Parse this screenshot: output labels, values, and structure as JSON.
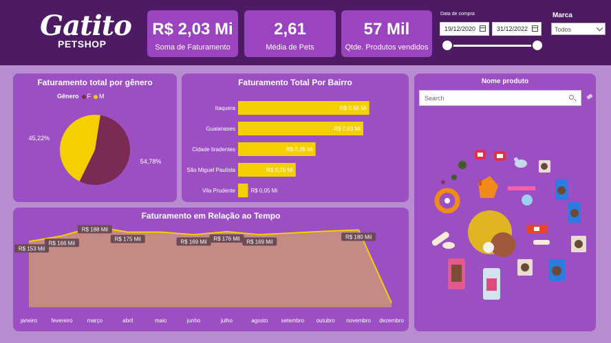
{
  "brand": {
    "logo_main": "Gatito",
    "logo_sub": "PETSHOP"
  },
  "kpis": [
    {
      "value": "R$ 2,03 Mi",
      "label": "Soma de Faturamento"
    },
    {
      "value": "2,61",
      "label": "Média de Pets"
    },
    {
      "value": "57 Mil",
      "label": "Qtde. Produtos vendidos"
    }
  ],
  "filters": {
    "date_label": "Data de compra",
    "date_start": "19/12/2020",
    "date_end": "31/12/2022",
    "brand_label": "Marca",
    "brand_value": "Todos"
  },
  "product_panel": {
    "title": "Nome produto",
    "search_placeholder": "Search"
  },
  "colors": {
    "header": "#4e1a63",
    "panel": "#9b4fc3",
    "female": "#7b2b53",
    "male": "#f5d000",
    "area": "#c58a84"
  },
  "chart_data": [
    {
      "type": "pie",
      "title": "Faturamento total por gênero",
      "legend_title": "Gênero",
      "legend_position": "top",
      "slices": [
        {
          "name": "F",
          "value": 54.78,
          "label": "54,78%"
        },
        {
          "name": "M",
          "value": 45.22,
          "label": "45,22%"
        }
      ]
    },
    {
      "type": "bar",
      "orientation": "horizontal",
      "title": "Faturamento Total Por Bairro",
      "categories": [
        "Itaquera",
        "Guaianases",
        "Cidade tiradentes",
        "São Miguel Paulista",
        "Vila Prudente"
      ],
      "values": [
        0.66,
        0.63,
        0.39,
        0.29,
        0.05
      ],
      "labels": [
        "R$ 0,66 Mi",
        "R$ 0,63 Mi",
        "R$ 0,39 Mi",
        "R$ 0,29 Mi",
        "R$ 0,05 Mi"
      ],
      "xlim": [
        0,
        0.72
      ]
    },
    {
      "type": "area",
      "title": "Faturamento em Relação ao Tempo",
      "x": [
        "janeiro",
        "fevereiro",
        "março",
        "abril",
        "maio",
        "junho",
        "julho",
        "agosto",
        "setembro",
        "outubro",
        "novembro",
        "dezembro"
      ],
      "values": [
        153,
        166,
        188,
        175,
        175,
        169,
        176,
        169,
        173,
        177,
        180,
        10
      ],
      "labels": [
        "R$ 153 Mil",
        "R$ 166 Mil",
        "R$ 188 Mil",
        "R$ 175 Mil",
        "",
        "R$ 169 Mil",
        "R$ 176 Mil",
        "R$ 169 Mil",
        "",
        "",
        "R$ 180 Mil",
        ""
      ],
      "ylim": [
        0,
        200
      ]
    }
  ]
}
